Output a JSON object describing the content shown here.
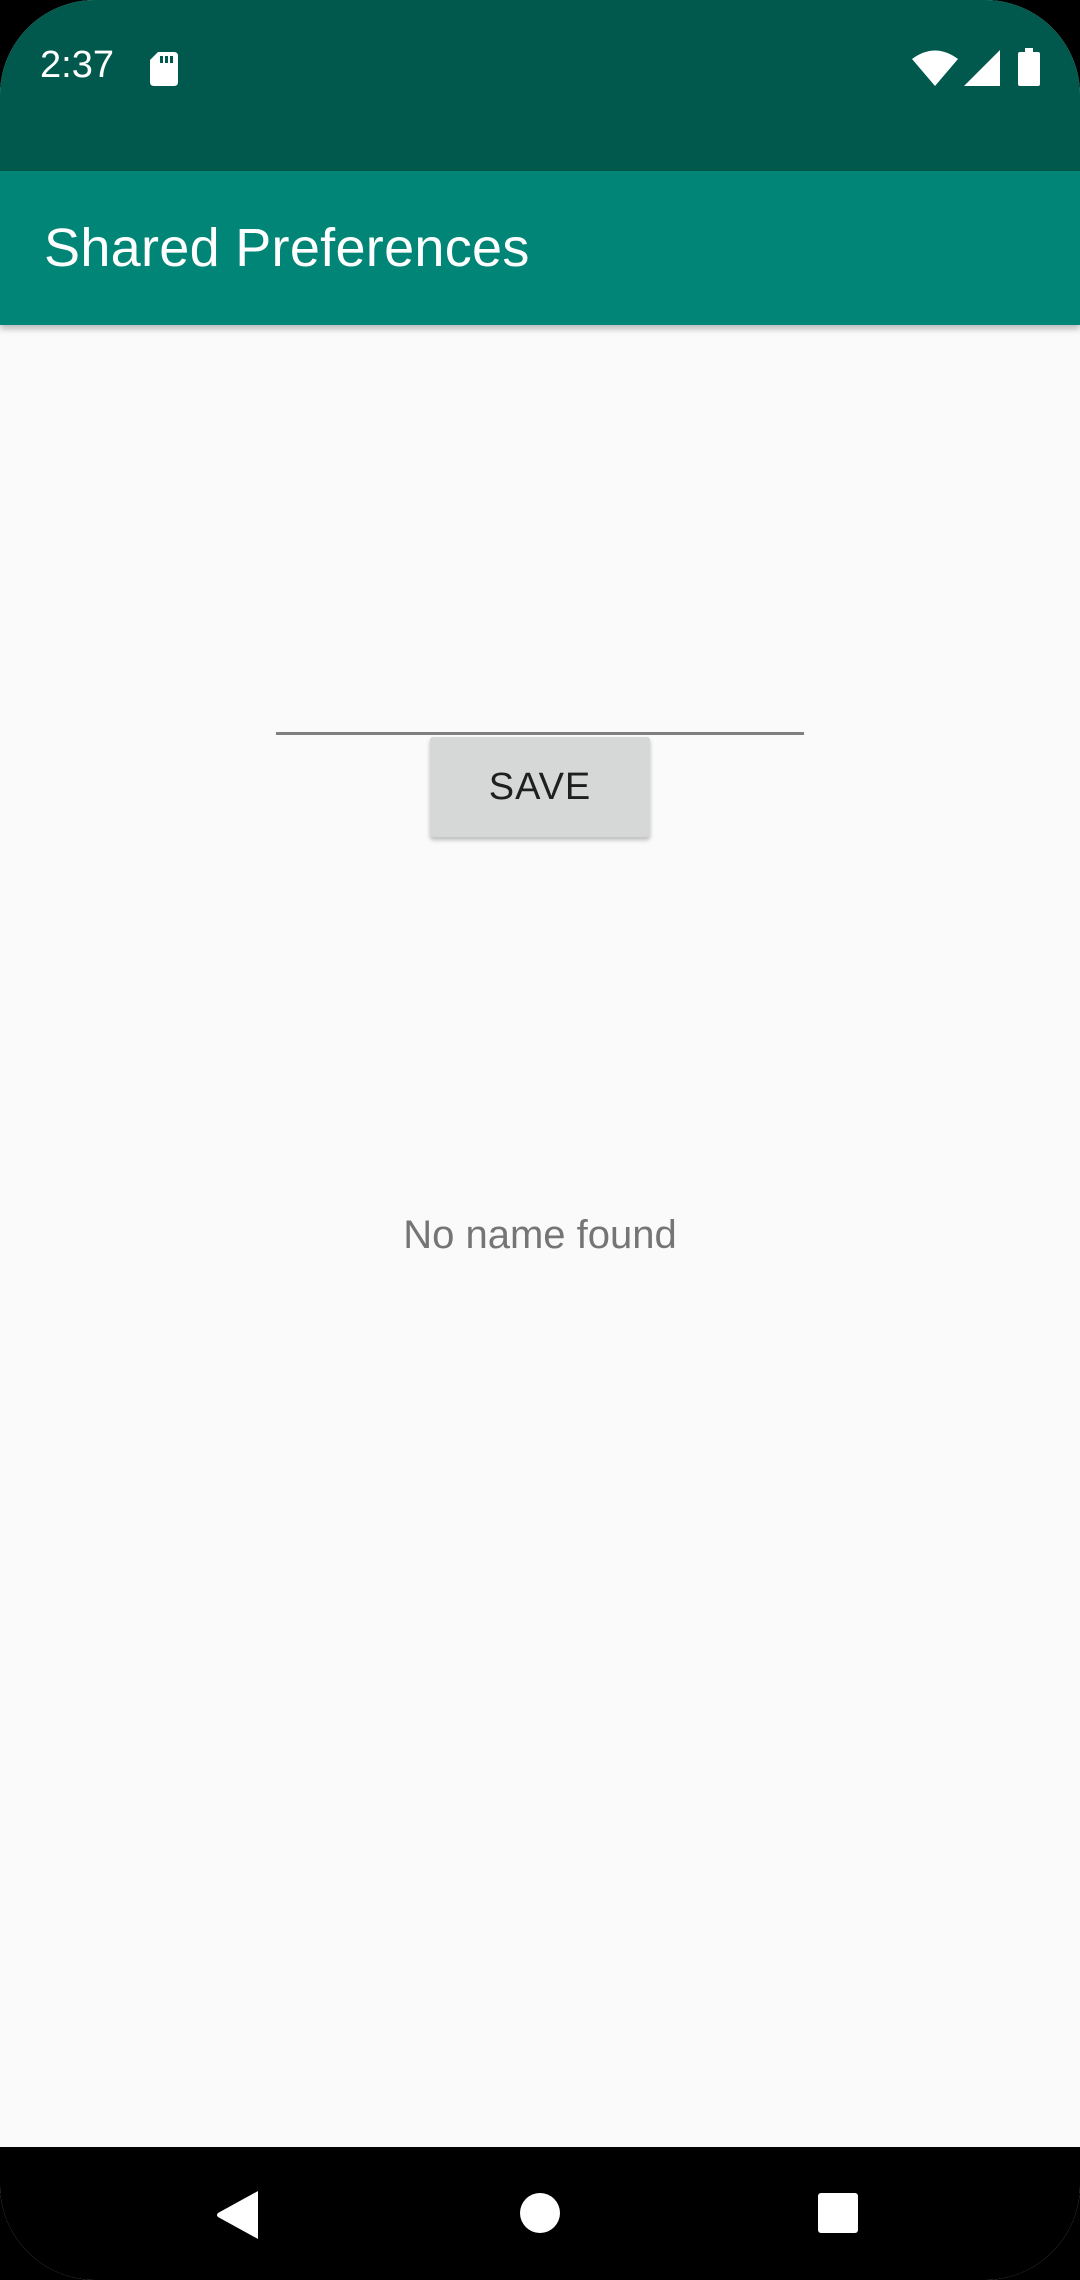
{
  "status_bar": {
    "time": "2:37",
    "icons": [
      "sd-card-icon",
      "wifi-icon",
      "cell-signal-icon",
      "battery-icon"
    ],
    "background_color": "#00594c"
  },
  "app_bar": {
    "title": "Shared Preferences",
    "background_color": "#008577"
  },
  "main": {
    "name_input": {
      "value": "",
      "placeholder": ""
    },
    "save_button_label": "SAVE",
    "result_text": "No name found"
  },
  "nav_bar": {
    "buttons": [
      "back-icon",
      "home-icon",
      "recents-icon"
    ]
  }
}
